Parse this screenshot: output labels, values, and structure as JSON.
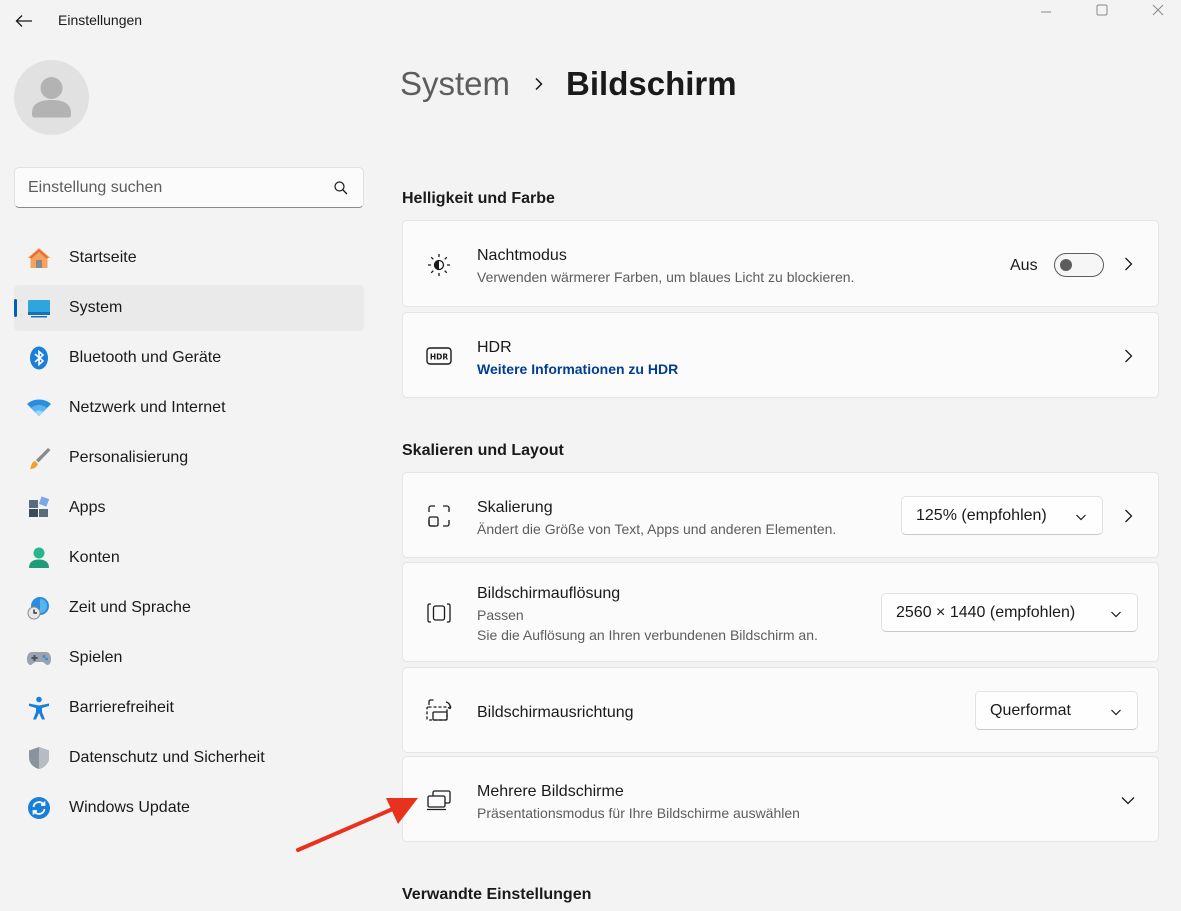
{
  "window": {
    "title": "Einstellungen"
  },
  "sidebar": {
    "search_placeholder": "Einstellung suchen",
    "items": [
      {
        "label": "Startseite",
        "icon": "home-icon"
      },
      {
        "label": "System",
        "icon": "system-display-icon",
        "active": true
      },
      {
        "label": "Bluetooth und Geräte",
        "icon": "bluetooth-icon"
      },
      {
        "label": "Netzwerk und Internet",
        "icon": "wifi-icon"
      },
      {
        "label": "Personalisierung",
        "icon": "brush-icon"
      },
      {
        "label": "Apps",
        "icon": "apps-icon"
      },
      {
        "label": "Konten",
        "icon": "account-icon"
      },
      {
        "label": "Zeit und Sprache",
        "icon": "time-language-icon"
      },
      {
        "label": "Spielen",
        "icon": "gamepad-icon"
      },
      {
        "label": "Barrierefreiheit",
        "icon": "accessibility-icon"
      },
      {
        "label": "Datenschutz und Sicherheit",
        "icon": "shield-icon"
      },
      {
        "label": "Windows Update",
        "icon": "update-icon"
      }
    ]
  },
  "breadcrumb": {
    "parent": "System",
    "current": "Bildschirm"
  },
  "sections": {
    "brightness": "Helligkeit und Farbe",
    "scale_layout": "Skalieren und Layout",
    "related": "Verwandte Einstellungen"
  },
  "cards": {
    "night_mode": {
      "title": "Nachtmodus",
      "subtitle": "Verwenden wärmerer Farben, um blaues Licht zu blockieren.",
      "toggle_label": "Aus",
      "toggle_on": false
    },
    "hdr": {
      "title": "HDR",
      "link": "Weitere Informationen zu HDR"
    },
    "scaling": {
      "title": "Skalierung",
      "subtitle": "Ändert die Größe von Text, Apps und anderen Elementen.",
      "value": "125% (empfohlen)"
    },
    "resolution": {
      "title": "Bildschirmauflösung",
      "subtitle1": "Passen",
      "subtitle2": "Sie die Auflösung an Ihren verbundenen Bildschirm an.",
      "value": "2560 × 1440 (empfohlen)"
    },
    "orientation": {
      "title": "Bildschirmausrichtung",
      "value": "Querformat"
    },
    "multiple_displays": {
      "title": "Mehrere Bildschirme",
      "subtitle": "Präsentationsmodus für Ihre Bildschirme auswählen"
    }
  },
  "colors": {
    "accent": "#005fb8",
    "link": "#003e92",
    "annotation_arrow": "#e8321e"
  }
}
